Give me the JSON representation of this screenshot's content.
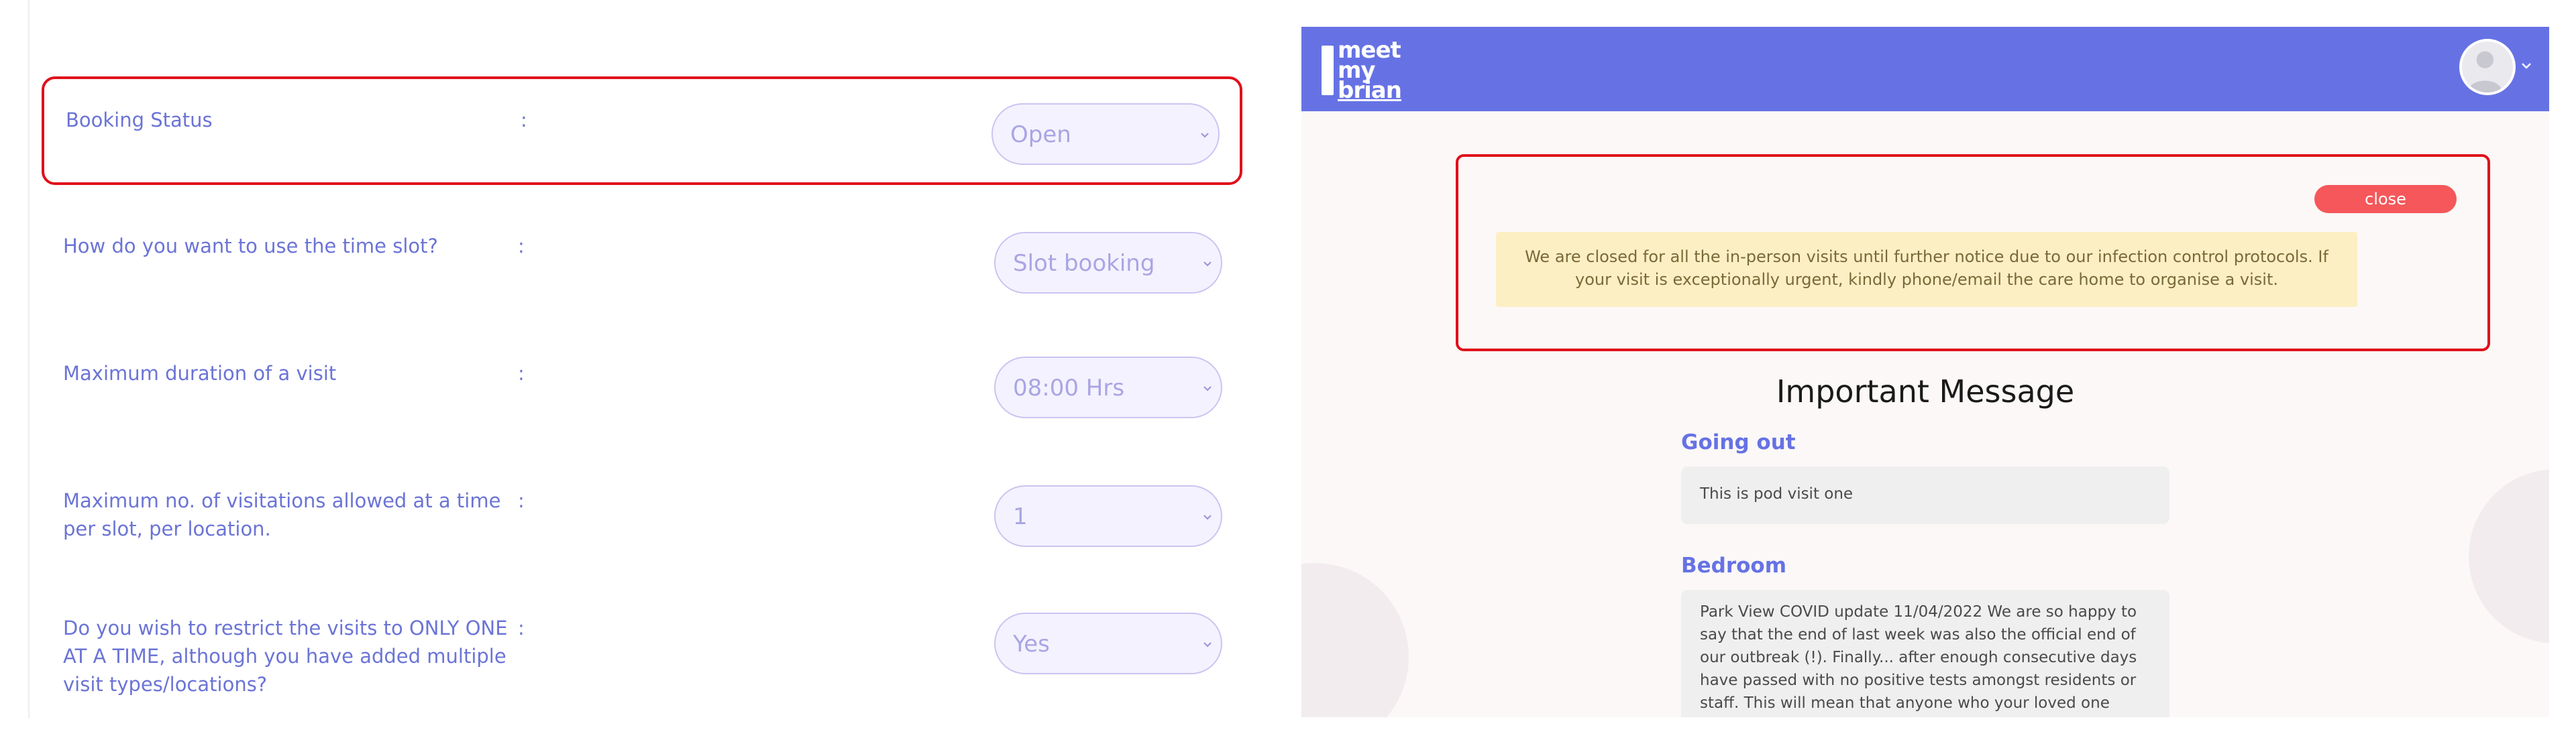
{
  "settings": {
    "rows": [
      {
        "label": "Booking Status",
        "colon": ":",
        "value": "Open"
      },
      {
        "label": "How do you want to use the time slot?",
        "colon": ":",
        "value": "Slot booking"
      },
      {
        "label": "Maximum duration of a visit",
        "colon": ":",
        "value": "08:00 Hrs"
      },
      {
        "label": "Maximum no. of visitations allowed at a time per slot, per location.",
        "colon": ":",
        "value": "1"
      },
      {
        "label": "Do you wish to restrict the visits to ONLY ONE AT A TIME, although you have added multiple visit types/locations?",
        "colon": ":",
        "value": "Yes"
      }
    ]
  },
  "app": {
    "logo": {
      "line1": "meet",
      "line2": "my",
      "line3": "brian"
    },
    "header_color": "#6672e4",
    "avatar_icon": "user-avatar-icon"
  },
  "notice": {
    "close_label": "close",
    "message": "We are closed for all the in-person visits until further notice due to our infection control protocols. If your visit is exceptionally urgent, kindly phone/email the care home to organise a visit."
  },
  "important": {
    "title": "Important Message",
    "sections": [
      {
        "heading": "Going out",
        "text": "This is pod visit one"
      },
      {
        "heading": "Bedroom",
        "text": "Park View COVID update 11/04/2022 We are so happy to say that the end of last week was also the official end of our outbreak (!). Finally... after enough consecutive days have passed with no positive tests amongst residents or staff. This will mean that anyone who your loved one would like"
      }
    ]
  },
  "colors": {
    "accent": "#6672e4",
    "highlight_border": "#e0101a",
    "close_button": "#f5575a",
    "notice_bg": "#fcefc4"
  }
}
